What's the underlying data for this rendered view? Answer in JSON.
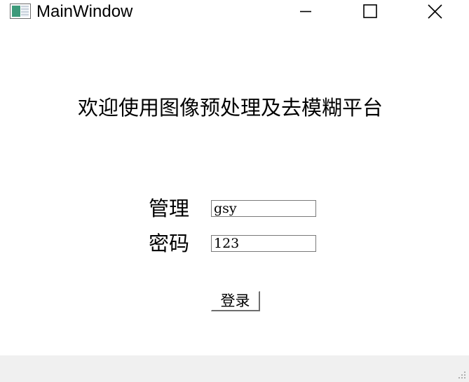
{
  "window": {
    "title": "MainWindow",
    "icon": "app-window-icon"
  },
  "title_controls": {
    "minimize": "minimize-icon",
    "maximize": "maximize-icon",
    "close": "close-icon"
  },
  "main": {
    "welcome_text": "欢迎使用图像预处理及去模糊平台",
    "username_label": "管理",
    "username_value": "gsy",
    "password_label": "密码",
    "password_value": "123",
    "login_button_label": "登录"
  },
  "statusbar": {
    "size_grip": "size-grip-icon"
  },
  "colors": {
    "background": "#ffffff",
    "statusbar": "#f0f0f0",
    "text": "#000000",
    "field_border": "#7a7a7a"
  }
}
